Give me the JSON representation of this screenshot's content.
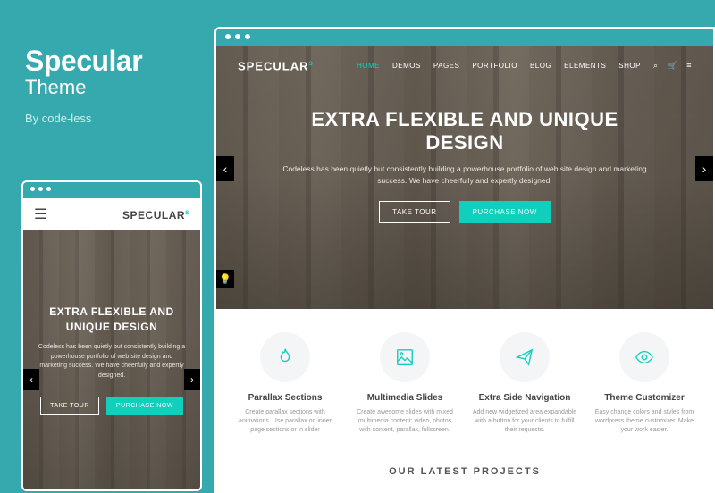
{
  "promo": {
    "title": "Specular",
    "subtitle": "Theme",
    "byline": "By code-less"
  },
  "logo": {
    "text": "SPECULAR",
    "sup": "s"
  },
  "nav": {
    "items": [
      {
        "label": "HOME",
        "active": true
      },
      {
        "label": "DEMOS",
        "active": false
      },
      {
        "label": "PAGES",
        "active": false
      },
      {
        "label": "PORTFOLIO",
        "active": false
      },
      {
        "label": "BLOG",
        "active": false
      },
      {
        "label": "ELEMENTS",
        "active": false
      },
      {
        "label": "SHOP",
        "active": false
      }
    ]
  },
  "hero": {
    "title": "EXTRA FLEXIBLE AND UNIQUE DESIGN",
    "subtitle": "Codeless has been quietly but consistently building a powerhouse portfolio of web site design and marketing success. We have cheerfully and expertly designed.",
    "take_tour": "TAKE TOUR",
    "purchase": "PURCHASE NOW"
  },
  "mobile_hero": {
    "title": "EXTRA FLEXIBLE AND UNIQUE DESIGN",
    "subtitle": "Codeless has been quietly but consistently building a powerhouse portfolio of web site design and marketing success. We have cheerfully and expertly designed.",
    "take_tour": "TAKE TOUR",
    "purchase": "PURCHASE NOW"
  },
  "features": [
    {
      "title": "Parallax Sections",
      "desc": "Create parallax sections with animations. Use parallax on inner page sections or in slider"
    },
    {
      "title": "Multimedia Slides",
      "desc": "Create awesome slides with mixed multimedia content: video, photos with content, parallax, fullscreen."
    },
    {
      "title": "Extra Side Navigation",
      "desc": "Add new widgetized area expandable with a button for your clients to fulfill their requests."
    },
    {
      "title": "Theme Customizer",
      "desc": "Easy change colors and styles from wordpress theme customizer. Make your work easier."
    }
  ],
  "section_heading": "OUR LATEST PROJECTS"
}
